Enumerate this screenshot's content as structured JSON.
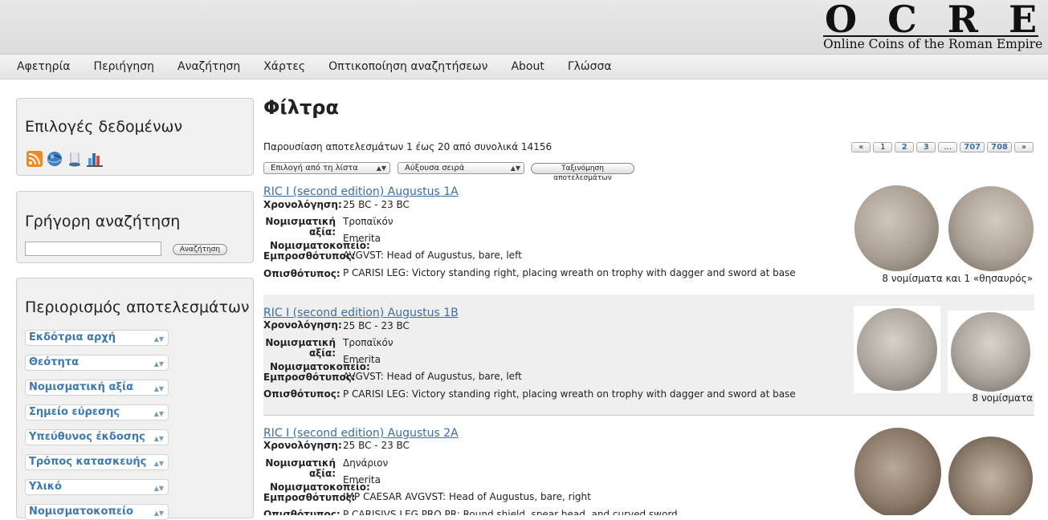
{
  "logo": {
    "letters": [
      "O",
      "C",
      "R",
      "E"
    ],
    "subtitle": "Online Coins of the Roman Empire"
  },
  "nav": [
    "Αφετηρία",
    "Περιήγηση",
    "Αναζήτηση",
    "Χάρτες",
    "Οπτικοποίηση αναζητήσεων",
    "About",
    "Γλώσσα"
  ],
  "sidebar": {
    "data_options_title": "Επιλογές δεδομένων",
    "data_icons": [
      "rss-icon",
      "globe-icon",
      "database-icon",
      "bar-chart-icon"
    ],
    "quick_search_title": "Γρήγορη αναζήτηση",
    "quick_search_value": "",
    "quick_search_button": "Αναζήτηση",
    "refine_title": "Περιορισμός αποτελεσμάτων",
    "facets": [
      "Εκδότρια αρχή",
      "Θεότητα",
      "Νομισματική αξία",
      "Σημείο εύρεσης",
      "Υπεύθυνος έκδοσης",
      "Τρόπος κατασκευής",
      "Υλικό",
      "Νομισματοκοπείο"
    ]
  },
  "main": {
    "title": "Φίλτρα",
    "summary": "Παρουσίαση αποτελεσμάτων 1 έως 20 από συνολικά 14156",
    "pager": [
      "«",
      "1",
      "2",
      "3",
      "...",
      "707",
      "708",
      "»"
    ],
    "select_list": "Επιλογή από τη λίστα",
    "select_order": "Αύξουσα σειρά",
    "sort_button": "Ταξινόμηση αποτελεσμάτων",
    "labels": {
      "date": "Χρονολόγηση:",
      "denomination": "Νομισματική αξία:",
      "mint": "Νομισματοκοπείο:",
      "obverse": "Εμπροσθότυπος:",
      "reverse": "Οπισθότυπος:"
    },
    "results": [
      {
        "title": "RIC I (second edition) Augustus 1A",
        "date": "25 BC - 23 BC",
        "denomination": "Τροπαϊκόν",
        "mint": "Emerita",
        "obverse": "AVGVST: Head of Augustus, bare, left",
        "reverse": "P CARISI LEG: Victory standing right, placing wreath on trophy with dagger and sword at base",
        "count": "8 νομίσματα και 1 «θησαυρός»"
      },
      {
        "title": "RIC I (second edition) Augustus 1B",
        "date": "25 BC - 23 BC",
        "denomination": "Τροπαϊκόν",
        "mint": "Emerita",
        "obverse": "AVGVST: Head of Augustus, bare, left",
        "reverse": "P CARISI LEG: Victory standing right, placing wreath on trophy with dagger and sword at base",
        "count": "8 νομίσματα"
      },
      {
        "title": "RIC I (second edition) Augustus 2A",
        "date": "25 BC - 23 BC",
        "denomination": "Δηνάριον",
        "mint": "Emerita",
        "obverse": "IMP CAESAR AVGVST: Head of Augustus, bare, right",
        "reverse": "P CARISIVS LEG PRO PR: Round shield, spear head, and curved sword",
        "count": ""
      }
    ]
  }
}
